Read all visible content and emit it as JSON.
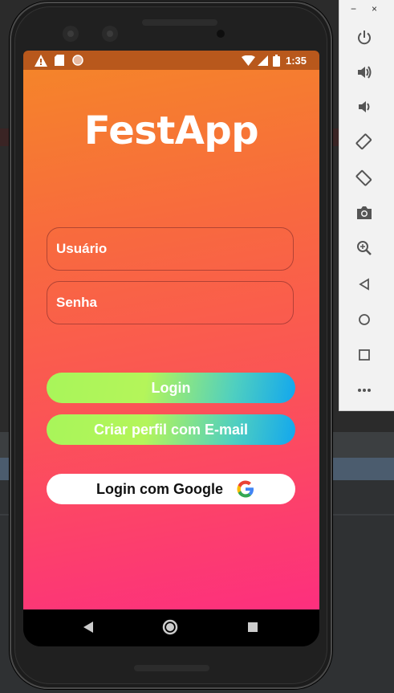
{
  "status_bar": {
    "time": "1:35",
    "left_icons": [
      "warning-icon",
      "sd-card-icon",
      "circle-icon"
    ],
    "right_icons": [
      "wifi-icon",
      "signal-icon",
      "battery-icon"
    ]
  },
  "app": {
    "title": "FestApp",
    "username_placeholder": "Usuário",
    "password_placeholder": "Senha",
    "login_button": "Login",
    "create_profile_button": "Criar perfil com E-mail",
    "google_login_button": "Login com Google"
  },
  "nav_bar": {
    "icons": [
      "back-icon",
      "home-icon",
      "recents-icon"
    ]
  },
  "emulator_panel": {
    "window_controls": [
      "−",
      "×"
    ],
    "tools": [
      "power-icon",
      "volume-up-icon",
      "volume-down-icon",
      "rotate-left-icon",
      "rotate-right-icon",
      "camera-icon",
      "zoom-icon",
      "back-icon",
      "home-icon",
      "overview-icon",
      "more-icon"
    ]
  },
  "colors": {
    "gradient_top": "#f5842a",
    "gradient_bottom": "#fd2f7e",
    "button_gradient_start": "#a8f55a",
    "button_gradient_end": "#12a7ee",
    "status_bar": "#b8581c"
  }
}
